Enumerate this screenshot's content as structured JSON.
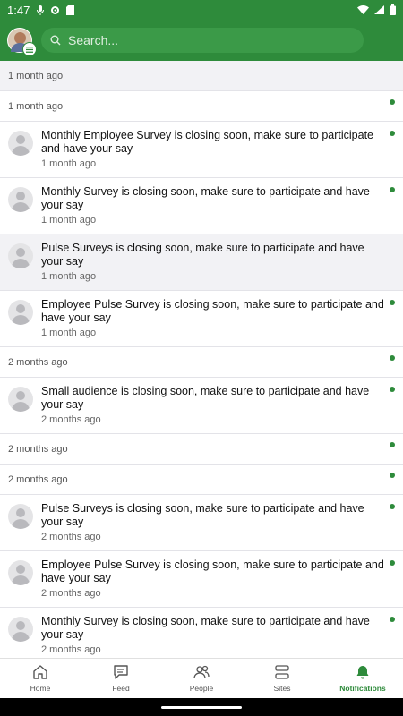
{
  "status": {
    "time": "1:47"
  },
  "search": {
    "placeholder": "Search..."
  },
  "rows": [
    {
      "type": "header",
      "grey": true,
      "label": "1 month ago",
      "unread": false
    },
    {
      "type": "header",
      "grey": false,
      "label": "1 month ago",
      "unread": true
    },
    {
      "type": "item",
      "grey": false,
      "message": "Monthly Employee Survey is closing soon, make sure to participate and have your say",
      "time": "1 month ago",
      "unread": true
    },
    {
      "type": "item",
      "grey": false,
      "message": "Monthly Survey is closing soon, make sure to participate and have your say",
      "time": "1 month ago",
      "unread": true
    },
    {
      "type": "item",
      "grey": true,
      "message": "Pulse Surveys is closing soon, make sure to participate and have your say",
      "time": "1 month ago",
      "unread": false
    },
    {
      "type": "item",
      "grey": false,
      "message": "Employee Pulse Survey is closing soon, make sure to participate and have your say",
      "time": "1 month ago",
      "unread": true
    },
    {
      "type": "header",
      "grey": false,
      "label": "2 months ago",
      "unread": true
    },
    {
      "type": "item",
      "grey": false,
      "message": "Small audience is closing soon, make sure to participate and have your say",
      "time": "2 months ago",
      "unread": true
    },
    {
      "type": "header",
      "grey": false,
      "label": "2 months ago",
      "unread": true
    },
    {
      "type": "header",
      "grey": false,
      "label": "2 months ago",
      "unread": true
    },
    {
      "type": "item",
      "grey": false,
      "message": "Pulse Surveys is closing soon, make sure to participate and have your say",
      "time": "2 months ago",
      "unread": true
    },
    {
      "type": "item",
      "grey": false,
      "message": "Employee Pulse Survey is closing soon, make sure to participate and have your say",
      "time": "2 months ago",
      "unread": true
    },
    {
      "type": "item",
      "grey": false,
      "message": "Monthly Survey is closing soon, make sure to participate and have your say",
      "time": "2 months ago",
      "unread": true
    }
  ],
  "nav": {
    "home": "Home",
    "feed": "Feed",
    "people": "People",
    "sites": "Sites",
    "notifications": "Notifications"
  },
  "colors": {
    "brand": "#2e8b3b",
    "unread_dot": "#2e8b3b"
  }
}
